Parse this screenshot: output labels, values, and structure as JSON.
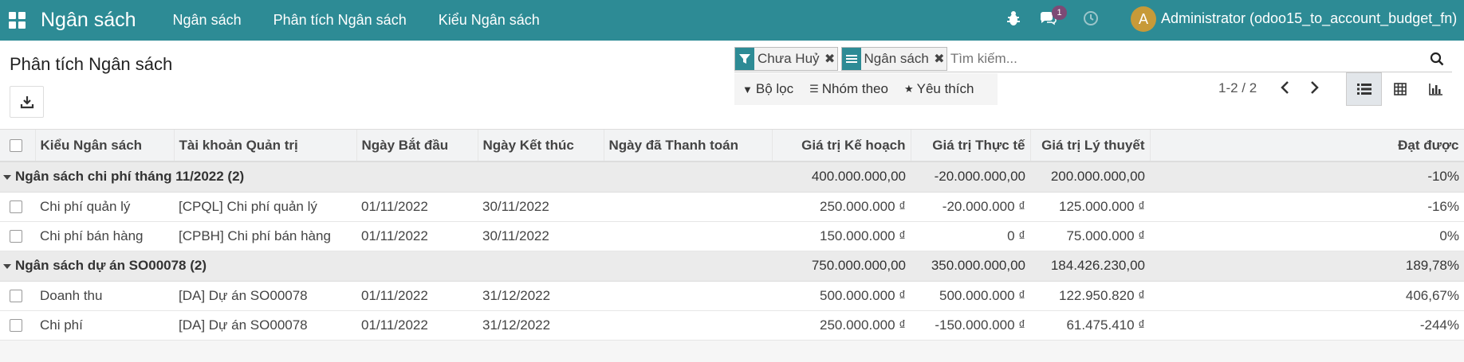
{
  "navbar": {
    "app_title": "Ngân sách",
    "menus": [
      "Ngân sách",
      "Phân tích Ngân sách",
      "Kiểu Ngân sách"
    ],
    "chat_badge": "1",
    "avatar_letter": "A",
    "user": "Administrator (odoo15_to_account_budget_fn)"
  },
  "page": {
    "title": "Phân tích Ngân sách"
  },
  "search": {
    "facets": [
      {
        "icon": "filter-icon",
        "label": "Chưa Huỷ"
      },
      {
        "icon": "group-by-icon",
        "label": "Ngân sách"
      }
    ],
    "placeholder": "Tìm kiếm..."
  },
  "filters": {
    "filter_label": "Bộ lọc",
    "groupby_label": "Nhóm theo",
    "favorites_label": "Yêu thích"
  },
  "pager": {
    "text": "1-2 / 2"
  },
  "views": [
    "list-view-icon",
    "pivot-view-icon",
    "graph-view-icon"
  ],
  "table": {
    "columns": [
      "Kiểu Ngân sách",
      "Tài khoản Quản trị",
      "Ngày Bắt đầu",
      "Ngày Kết thúc",
      "Ngày đã Thanh toán",
      "Giá trị Kế hoạch",
      "Giá trị Thực tế",
      "Giá trị Lý thuyết",
      "Đạt được"
    ],
    "groups": [
      {
        "label": "Ngân sách chi phí tháng 11/2022 (2)",
        "planned": "400.000.000,00",
        "practical": "-20.000.000,00",
        "theoretical": "200.000.000,00",
        "achieved": "-10%",
        "rows": [
          {
            "type": "Chi phí quản lý",
            "account": "[CPQL] Chi phí quản lý",
            "start": "01/11/2022",
            "end": "30/11/2022",
            "paid": "",
            "planned": "250.000.000 ₫",
            "practical": "-20.000.000 ₫",
            "theoretical": "125.000.000 ₫",
            "achieved": "-16%"
          },
          {
            "type": "Chi phí bán hàng",
            "account": "[CPBH] Chi phí bán hàng",
            "start": "01/11/2022",
            "end": "30/11/2022",
            "paid": "",
            "planned": "150.000.000 ₫",
            "practical": "0 ₫",
            "theoretical": "75.000.000 ₫",
            "achieved": "0%"
          }
        ]
      },
      {
        "label": "Ngân sách dự án SO00078 (2)",
        "planned": "750.000.000,00",
        "practical": "350.000.000,00",
        "theoretical": "184.426.230,00",
        "achieved": "189,78%",
        "rows": [
          {
            "type": "Doanh thu",
            "account": "[DA] Dự án SO00078",
            "start": "01/11/2022",
            "end": "31/12/2022",
            "paid": "",
            "planned": "500.000.000 ₫",
            "practical": "500.000.000 ₫",
            "theoretical": "122.950.820 ₫",
            "achieved": "406,67%"
          },
          {
            "type": "Chi phí",
            "account": "[DA] Dự án SO00078",
            "start": "01/11/2022",
            "end": "31/12/2022",
            "paid": "",
            "planned": "250.000.000 ₫",
            "practical": "-150.000.000 ₫",
            "theoretical": "61.475.410 ₫",
            "achieved": "-244%"
          }
        ]
      }
    ]
  }
}
